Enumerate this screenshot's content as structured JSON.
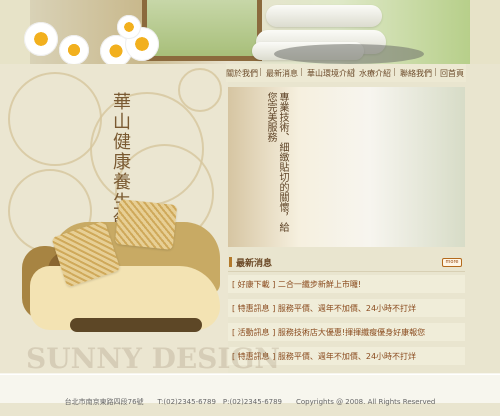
{
  "site": {
    "vertical_title": "華山健康養生館"
  },
  "nav": {
    "items": [
      "關於我們",
      "最新消息",
      "華山環境介紹",
      "水療介紹",
      "聯絡我們",
      "回首頁"
    ]
  },
  "promo": {
    "vertical_text": "專業技術、細緻貼切的關懷，給您完美服務"
  },
  "news": {
    "title": "最新消息",
    "more_label": "more",
    "items": [
      "[ 好康下載 ] 二合一纖步新鮮上市囉!",
      "[ 特惠訊息 ] 服務平價、週年不加價、24小時不打烊",
      "[ 活動訊息 ] 服務技術店大優惠!揮揮纖瘦優身好康報您",
      "[ 特惠訊息 ] 服務平價、週年不加價、24小時不打烊"
    ]
  },
  "footer": {
    "text": "台北市南京東路四段76號　　T:(02)2345-6789　P:(02)2345-6789　　Copyrights @ 2008. All Rights Reserved"
  },
  "colors": {
    "background": "#e9e5cf",
    "accent_brown": "#6b4a2a",
    "highlight_orange": "#b37a2c"
  },
  "icons": [
    "daisy-icon",
    "swirl-decor",
    "more-icon"
  ]
}
